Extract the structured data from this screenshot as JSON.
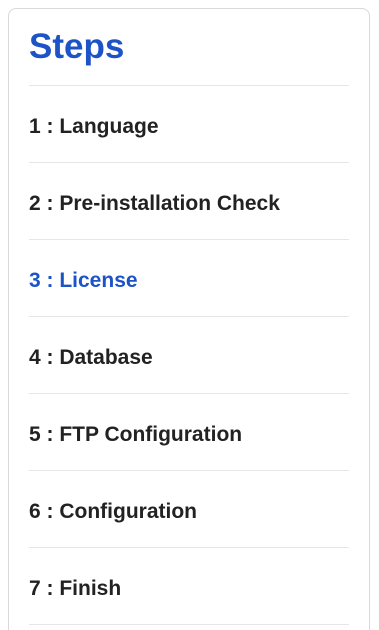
{
  "panel": {
    "title": "Steps",
    "active_color": "#1c53c7",
    "text_color": "#222222",
    "steps": [
      {
        "label": "1 : Language",
        "active": false
      },
      {
        "label": "2 : Pre-installation Check",
        "active": false
      },
      {
        "label": "3 : License",
        "active": true
      },
      {
        "label": "4 : Database",
        "active": false
      },
      {
        "label": "5 : FTP Configuration",
        "active": false
      },
      {
        "label": "6 : Configuration",
        "active": false
      },
      {
        "label": "7 : Finish",
        "active": false
      }
    ]
  }
}
